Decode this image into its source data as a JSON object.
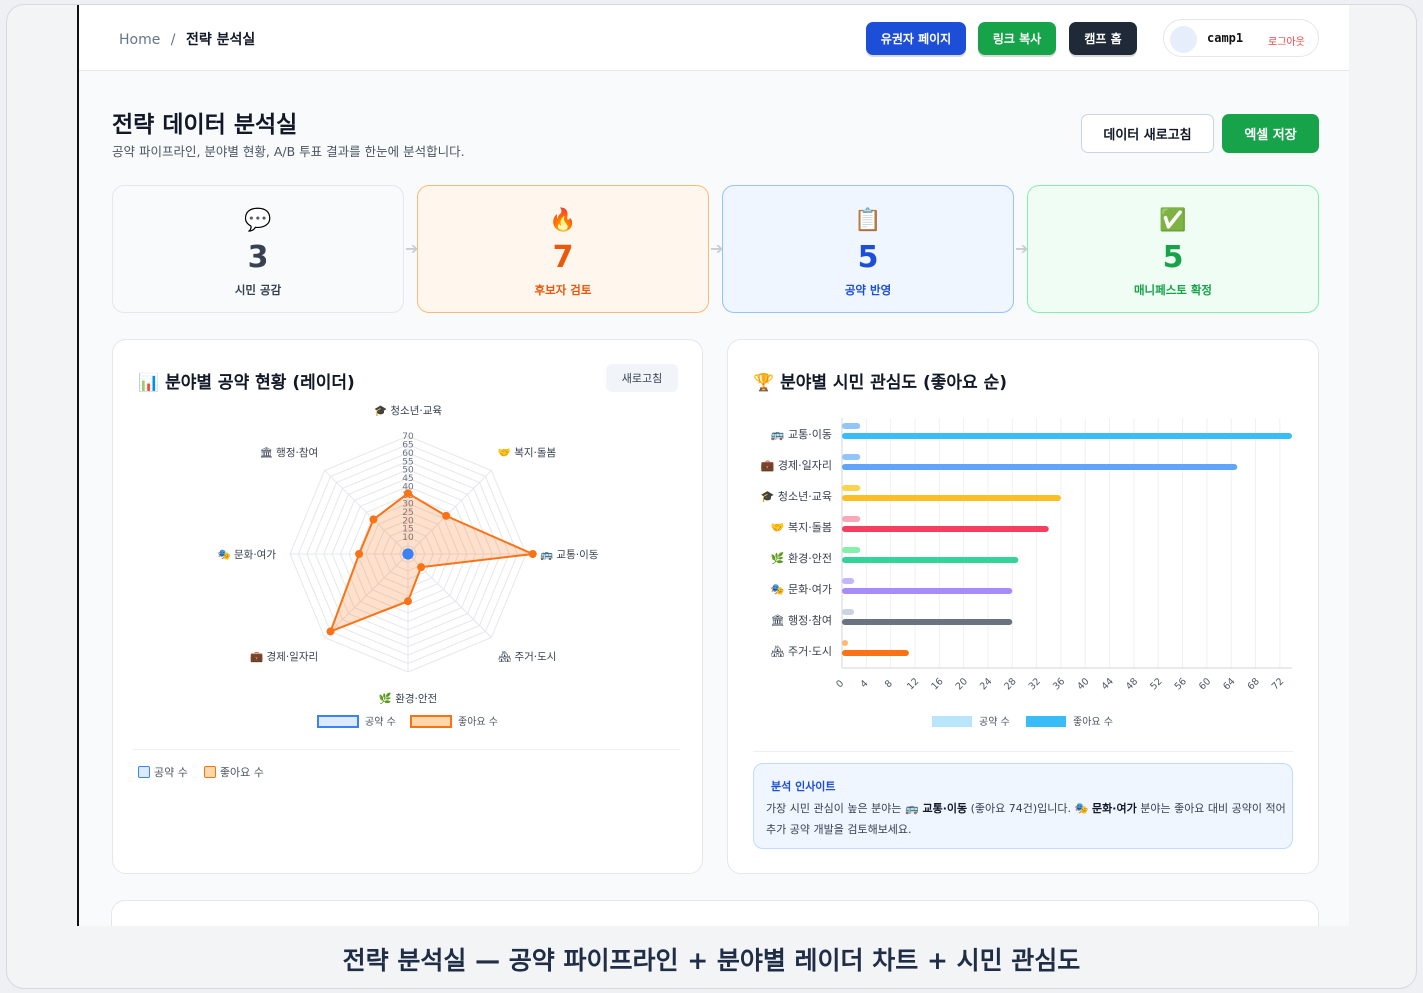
{
  "breadcrumb": {
    "home": "Home",
    "separator": "/",
    "current": "전략 분석실"
  },
  "topbar": {
    "buttons": [
      {
        "label": "유권자 페이지",
        "color": "#1d4ed8"
      },
      {
        "label": "링크 복사",
        "color": "#16a34a"
      },
      {
        "label": "캠프 홈",
        "color": "#1f2937"
      }
    ],
    "user": {
      "name": "camp1",
      "logout": "로그아웃"
    }
  },
  "header": {
    "title": "전략 데이터 분석실",
    "subtitle": "공약 파이프라인, 분야별 현황, A/B 투표 결과를 한눈에 분석합니다.",
    "refresh_label": "데이터 새로고침",
    "excel_label": "엑셀 저장"
  },
  "pipeline": [
    {
      "icon": "💬",
      "value": "3",
      "label": "시민 공감",
      "color": "#374151"
    },
    {
      "icon": "🔥",
      "value": "7",
      "label": "후보자 검토",
      "color": "#ea580c"
    },
    {
      "icon": "📋",
      "value": "5",
      "label": "공약 반영",
      "color": "#1d4ed8"
    },
    {
      "icon": "✅",
      "value": "5",
      "label": "매니페스토 확정",
      "color": "#16a34a"
    }
  ],
  "radar_panel": {
    "title": "📊 분야별 공약 현황 (레이더)",
    "refresh_label": "새로고침",
    "legend_bottom": [
      "공약 수",
      "좋아요 수"
    ]
  },
  "bar_panel": {
    "title": "🏆 분야별 시민 관심도 (좋아요 순)",
    "insight_title": "분석 인사이트",
    "insight_parts": {
      "p1": "가장 시민 관심이 높은 분야는 ",
      "top": "🚌 교통·이동",
      "p2": " (좋아요 74건)입니다. ",
      "low": "🎭 문화·여가",
      "p3": " 분야는 좋아요 대비 공약이 적어 추가 공약 개발을 검토해보세요."
    }
  },
  "caption": "전략 분석실 — 공약 파이프라인 + 분야별 레이더 차트 + 시민 관심도",
  "chart_data": [
    {
      "type": "radar",
      "categories": [
        "🎓 청소년·교육",
        "🤝 복지·돌봄",
        "🚌 교통·이동",
        "🏘 주거·도시",
        "🌿 환경·안전",
        "💼 경제·일자리",
        "🎭 문화·여가",
        "🏛 행정·참여"
      ],
      "series": [
        {
          "name": "공약 수",
          "values": [
            1,
            1,
            1,
            1,
            1,
            1,
            1,
            1
          ],
          "color": "#3b82f6"
        },
        {
          "name": "좋아요 수",
          "values": [
            36,
            32,
            74,
            11,
            28,
            65,
            29,
            29
          ],
          "color": "#f97316"
        }
      ],
      "rlim": [
        0,
        70
      ],
      "ticks": [
        10,
        15,
        20,
        25,
        30,
        35,
        40,
        45,
        50,
        55,
        60,
        65,
        70
      ],
      "legend": "bottom"
    },
    {
      "type": "bar",
      "orientation": "horizontal",
      "categories": [
        "🚌 교통·이동",
        "💼 경제·일자리",
        "🎓 청소년·교육",
        "🤝 복지·돌봄",
        "🌿 환경·안전",
        "🎭 문화·여가",
        "🏛 행정·참여",
        "🏘 주거·도시"
      ],
      "series": [
        {
          "name": "공약 수",
          "values": [
            3,
            3,
            3,
            3,
            3,
            2,
            2,
            1
          ],
          "colors": [
            "#93c5fd",
            "#93c5fd",
            "#fcd34d",
            "#f9a8b8",
            "#86efac",
            "#c4b5fd",
            "#cbd5e1",
            "#fdba74"
          ]
        },
        {
          "name": "좋아요 수",
          "values": [
            74,
            65,
            36,
            34,
            29,
            28,
            28,
            11
          ],
          "colors": [
            "#38bdf8",
            "#60a5fa",
            "#fbbf24",
            "#f43f5e",
            "#34d399",
            "#a78bfa",
            "#6b7280",
            "#f97316"
          ]
        }
      ],
      "xlim": [
        0,
        74
      ],
      "xticks": [
        0,
        4,
        8,
        12,
        16,
        20,
        24,
        28,
        32,
        36,
        40,
        44,
        48,
        52,
        56,
        60,
        64,
        68,
        72
      ],
      "legend": "bottom",
      "legend_colors": [
        "#bae6fd",
        "#38bdf8"
      ]
    }
  ]
}
